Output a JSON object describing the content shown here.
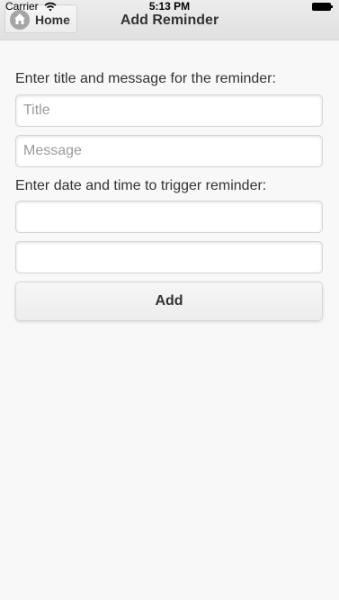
{
  "status_bar": {
    "carrier": "Carrier",
    "time": "5:13 PM",
    "wifi_icon": "wifi-icon",
    "battery_icon": "battery-icon"
  },
  "header": {
    "home_button_label": "Home",
    "home_icon": "home-icon",
    "title": "Add Reminder"
  },
  "form": {
    "title_message_label": "Enter title and message for the reminder:",
    "title_placeholder": "Title",
    "title_value": "",
    "message_placeholder": "Message",
    "message_value": "",
    "datetime_label": "Enter date and time to trigger reminder:",
    "date_value": "",
    "time_value": "",
    "add_button_label": "Add"
  },
  "colors": {
    "background": "#f8f8f8",
    "header_background": "#e6e6e6",
    "text": "#333333",
    "placeholder": "#9a9a9a"
  }
}
